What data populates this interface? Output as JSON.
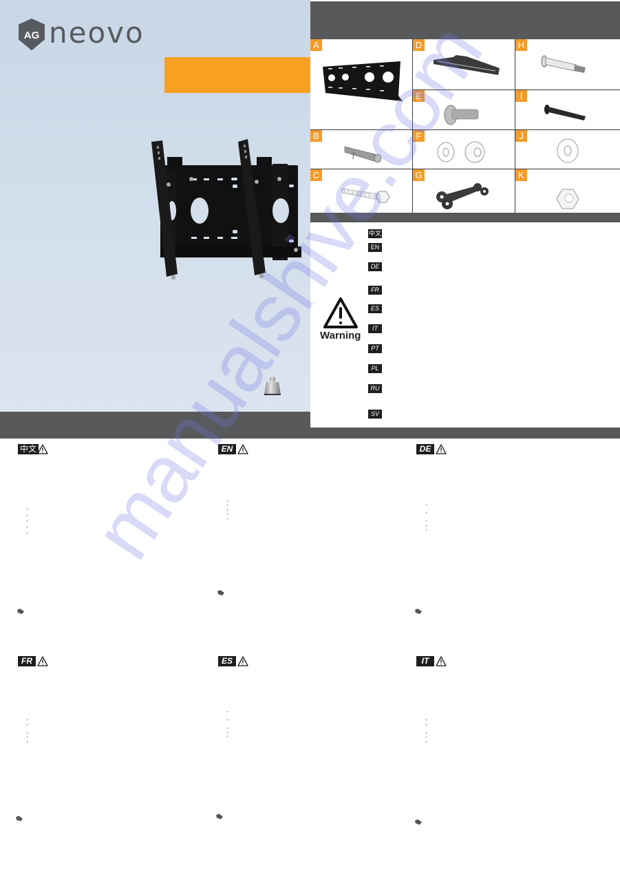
{
  "brand": {
    "logo_mark": "AG",
    "logo_text": "neovo",
    "accent_color": "#f7a021",
    "bar_color": "#58595b",
    "cover_bg": "#cfdbe9"
  },
  "cover": {
    "product_image": "tilt-wall-mount-bracket",
    "weight_icon": "weight-icon"
  },
  "parts": [
    {
      "letter": "A",
      "name": "wall-plate"
    },
    {
      "letter": "B",
      "name": "wall-anchor"
    },
    {
      "letter": "C",
      "name": "lag-bolt"
    },
    {
      "letter": "D",
      "name": "mounting-arm"
    },
    {
      "letter": "E",
      "name": "flange-screw"
    },
    {
      "letter": "F",
      "name": "washers-and-spacer"
    },
    {
      "letter": "G",
      "name": "link-bracket"
    },
    {
      "letter": "H",
      "name": "shoulder-bolt-silver"
    },
    {
      "letter": "I",
      "name": "shoulder-bolt-black"
    },
    {
      "letter": "J",
      "name": "washer"
    },
    {
      "letter": "K",
      "name": "hex-nut"
    }
  ],
  "warning": {
    "label": "Warning",
    "languages": [
      "中文",
      "EN",
      "DE",
      "FR",
      "ES",
      "IT",
      "PT",
      "PL",
      "RU",
      "SV"
    ]
  },
  "sections": [
    {
      "lang": "中文",
      "bullets": 5
    },
    {
      "lang": "EN",
      "bullets": 5
    },
    {
      "lang": "DE",
      "bullets": 5
    },
    {
      "lang": "FR",
      "bullets": 5
    },
    {
      "lang": "ES",
      "bullets": 5
    },
    {
      "lang": "IT",
      "bullets": 5
    }
  ],
  "watermark": "manualshive.com"
}
